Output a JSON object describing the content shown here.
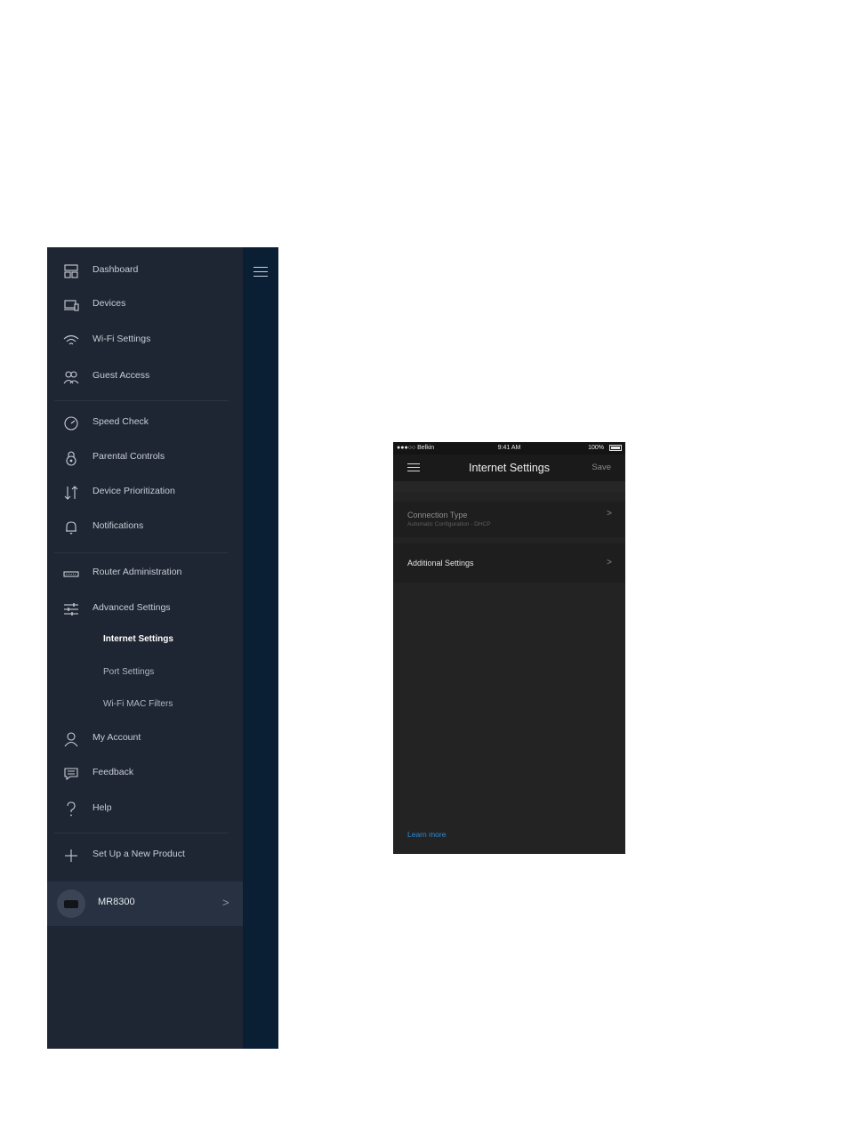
{
  "drawer": {
    "items": [
      {
        "label": "Dashboard",
        "icon": "dashboard-icon"
      },
      {
        "label": "Devices",
        "icon": "devices-icon"
      },
      {
        "label": "Wi-Fi Settings",
        "icon": "wifi-icon"
      },
      {
        "label": "Guest Access",
        "icon": "guest-icon"
      },
      {
        "label": "Speed Check",
        "icon": "speedometer-icon"
      },
      {
        "label": "Parental Controls",
        "icon": "parental-lock-icon"
      },
      {
        "label": "Device Prioritization",
        "icon": "priority-arrows-icon"
      },
      {
        "label": "Notifications",
        "icon": "bell-icon"
      },
      {
        "label": "Router Administration",
        "icon": "router-icon"
      },
      {
        "label": "Advanced Settings",
        "icon": "sliders-icon"
      },
      {
        "label": "My Account",
        "icon": "user-icon"
      },
      {
        "label": "Feedback",
        "icon": "chat-icon"
      },
      {
        "label": "Help",
        "icon": "question-icon"
      },
      {
        "label": "Set Up a New Product",
        "icon": "plus-icon"
      }
    ],
    "sub_items": [
      {
        "label": "Internet Settings",
        "active": true
      },
      {
        "label": "Port Settings",
        "active": false
      },
      {
        "label": "Wi-Fi MAC Filters",
        "active": false
      }
    ],
    "device": {
      "name": "MR8300",
      "chevron": ">"
    }
  },
  "phone": {
    "status": {
      "carrier": "●●●○○ Belkin",
      "time": "9:41 AM",
      "battery": "100%"
    },
    "title": "Internet Settings",
    "save_label": "Save",
    "rows": [
      {
        "title": "Connection Type",
        "subtitle": "Automatic Configuration - DHCP",
        "chevron": ">"
      },
      {
        "title": "Additional Settings",
        "chevron": ">"
      }
    ],
    "learn_more": "Learn more"
  },
  "colors": {
    "drawer_bg": "#1f2633",
    "edge_bg": "#0b1f34",
    "phone_bg": "#232323",
    "link": "#2b8bd6"
  }
}
